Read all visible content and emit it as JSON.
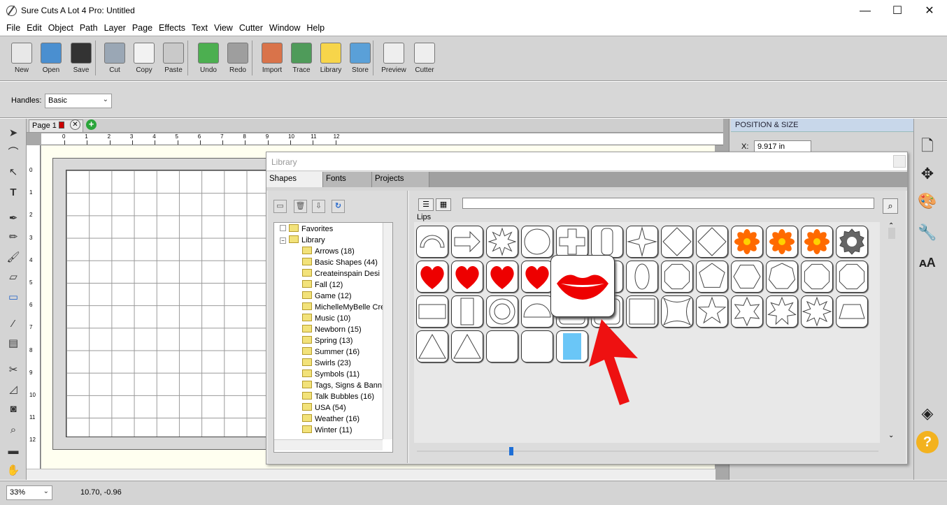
{
  "window": {
    "title": "Sure Cuts A Lot 4 Pro: Untitled",
    "minimize": "—",
    "maximize": "☐",
    "close": "✕"
  },
  "menu": [
    "File",
    "Edit",
    "Object",
    "Path",
    "Layer",
    "Page",
    "Effects",
    "Text",
    "View",
    "Cutter",
    "Window",
    "Help"
  ],
  "toolbar": [
    {
      "label": "New",
      "icon": "new-document-icon",
      "color": "#e8e8e8"
    },
    {
      "label": "Open",
      "icon": "open-folder-icon",
      "color": "#4a8fd0"
    },
    {
      "label": "Save",
      "icon": "floppy-disk-icon",
      "color": "#333333"
    },
    {
      "label": "Cut",
      "icon": "scissors-icon",
      "color": "#9aa7b5"
    },
    {
      "label": "Copy",
      "icon": "copy-icon",
      "color": "#f2f2f2"
    },
    {
      "label": "Paste",
      "icon": "paste-icon",
      "color": "#c9c9c9"
    },
    {
      "label": "Undo",
      "icon": "undo-icon",
      "color": "#4caf50"
    },
    {
      "label": "Redo",
      "icon": "redo-icon",
      "color": "#9e9e9e"
    },
    {
      "label": "Import",
      "icon": "import-svg-icon",
      "color": "#d9734a"
    },
    {
      "label": "Trace",
      "icon": "trace-icon",
      "color": "#4f9b5a"
    },
    {
      "label": "Library",
      "icon": "library-star-icon",
      "color": "#f7d54a"
    },
    {
      "label": "Store",
      "icon": "store-cart-icon",
      "color": "#5aa0d8"
    },
    {
      "label": "Preview",
      "icon": "preview-magnifier-icon",
      "color": "#eeeeee"
    },
    {
      "label": "Cutter",
      "icon": "cutter-pen-icon",
      "color": "#eeeeee"
    }
  ],
  "handles": {
    "label": "Handles:",
    "value": "Basic"
  },
  "page_tab": {
    "label": "Page 1"
  },
  "ruler_h": [
    "0",
    "1",
    "2",
    "3",
    "4",
    "5",
    "6",
    "7",
    "8",
    "9",
    "10",
    "11",
    "12"
  ],
  "ruler_v": [
    "0",
    "1",
    "2",
    "3",
    "4",
    "5",
    "6",
    "7",
    "8",
    "9",
    "10",
    "11",
    "12"
  ],
  "right_panel": {
    "title": "POSITION & SIZE",
    "x_label": "X:",
    "x_value": "9.917 in"
  },
  "status": {
    "zoom": "33%",
    "coords": "10.70, -0.96"
  },
  "library": {
    "title": "Library",
    "tabs": [
      "Shapes",
      "Fonts",
      "Projects"
    ],
    "search_value": "",
    "current_folder": "Lips",
    "tree": [
      {
        "label": "Favorites",
        "level": 1,
        "expander": ""
      },
      {
        "label": "Library",
        "level": 1,
        "expander": "−"
      },
      {
        "label": "Arrows (18)",
        "level": 2
      },
      {
        "label": "Basic Shapes (44)",
        "level": 2
      },
      {
        "label": "Createinspain Desi",
        "level": 2
      },
      {
        "label": "Fall (12)",
        "level": 2
      },
      {
        "label": "Game (12)",
        "level": 2
      },
      {
        "label": "MichelleMyBelle Cre",
        "level": 2
      },
      {
        "label": "Music (10)",
        "level": 2
      },
      {
        "label": "Newborn (15)",
        "level": 2
      },
      {
        "label": "Spring (13)",
        "level": 2
      },
      {
        "label": "Summer (16)",
        "level": 2
      },
      {
        "label": "Swirls (23)",
        "level": 2
      },
      {
        "label": "Symbols (11)",
        "level": 2
      },
      {
        "label": "Tags, Signs & Bann",
        "level": 2
      },
      {
        "label": "Talk Bubbles (16)",
        "level": 2
      },
      {
        "label": "USA (54)",
        "level": 2
      },
      {
        "label": "Weather (16)",
        "level": 2
      },
      {
        "label": "Winter (11)",
        "level": 2
      }
    ],
    "shapes": [
      "arch",
      "arrow",
      "asterisk",
      "circle",
      "cross",
      "rounded-rect-tall",
      "star4",
      "diamond",
      "diamond",
      "flower-orange",
      "flower-orange",
      "flower-orange",
      "gear",
      "heart",
      "heart",
      "heart",
      "heart",
      "lips-hidden",
      "blank",
      "ellipse-tall",
      "octagon",
      "pentagon",
      "hexagon",
      "heptagon",
      "octagon",
      "octagon",
      "rect-wide",
      "rect-tall",
      "ring",
      "semicircle",
      "rounded-square",
      "rounded-square",
      "square",
      "star4-concave",
      "star5",
      "star6",
      "star7",
      "star8",
      "trapezoid",
      "triangle",
      "triangle",
      "blank",
      "blank",
      "blue-rect"
    ],
    "popup_shape": "lips-icon",
    "colors": {
      "heart": "#ee0000",
      "flower": "#ff6a00",
      "flower_center": "#ffd200",
      "blue": "#6ac6f7",
      "lips": "#ee0000",
      "arrow": "#ee1111"
    }
  }
}
